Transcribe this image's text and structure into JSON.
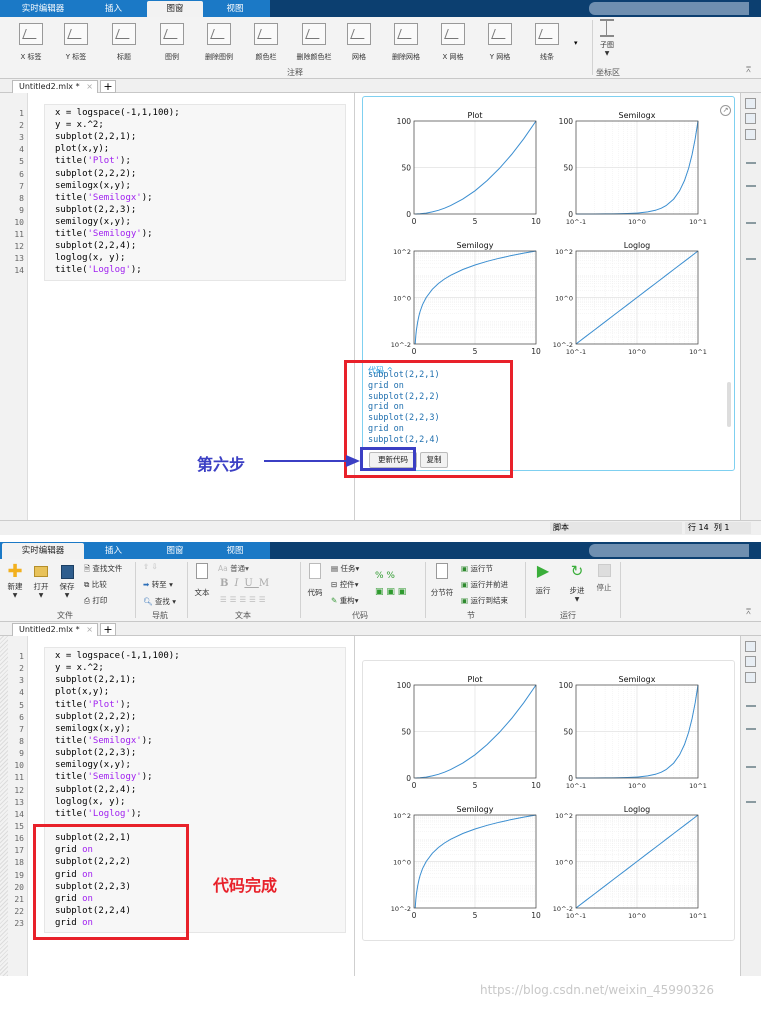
{
  "top": {
    "tabs": [
      "实时编辑器",
      "插入",
      "图窗",
      "视图"
    ],
    "active_tab": 2,
    "ribbon_items": [
      "X 标签",
      "Y 标签",
      "标题",
      "图例",
      "删除图例",
      "颜色栏",
      "删除颜色栏",
      "网格",
      "删除网格",
      "X 网格",
      "Y 网格",
      "线条"
    ],
    "subplot_label": "子图",
    "groups": [
      "注释",
      "坐标区"
    ],
    "doc_tab": "Untitled2.mlx *",
    "code_lines": [
      [
        [
          "x = logspace(-1,1,100);",
          "c"
        ]
      ],
      [
        [
          "y = x.^2;",
          "c"
        ]
      ],
      [
        [
          "subplot(2,2,1);",
          "c"
        ]
      ],
      [
        [
          "plot(x,y);",
          "c"
        ]
      ],
      [
        [
          "title(",
          "c"
        ],
        [
          "'Plot'",
          "s"
        ],
        [
          ");",
          "c"
        ]
      ],
      [
        [
          "subplot(2,2,2);",
          "c"
        ]
      ],
      [
        [
          "semilogx(x,y);",
          "c"
        ]
      ],
      [
        [
          "title(",
          "c"
        ],
        [
          "'Semilogx'",
          "s"
        ],
        [
          ");",
          "c"
        ]
      ],
      [
        [
          "subplot(2,2,3);",
          "c"
        ]
      ],
      [
        [
          "semilogy(x,y);",
          "c"
        ]
      ],
      [
        [
          "title(",
          "c"
        ],
        [
          "'Semilogy'",
          "s"
        ],
        [
          ");",
          "c"
        ]
      ],
      [
        [
          "subplot(2,2,4);",
          "c"
        ]
      ],
      [
        [
          "loglog(x, y);",
          "c"
        ]
      ],
      [
        [
          "title(",
          "c"
        ],
        [
          "'Loglog'",
          "s"
        ],
        [
          ");",
          "c"
        ]
      ]
    ],
    "generated_code": {
      "header": "代码 ^",
      "lines": [
        "subplot(2,2,1)",
        "grid on",
        "subplot(2,2,2)",
        "grid on",
        "subplot(2,2,3)",
        "grid on",
        "subplot(2,2,4)",
        "grid on"
      ],
      "update_button": "更新代码",
      "copy_button": "复制"
    },
    "annotation_step": "第六步",
    "status": {
      "mode": "脚本",
      "row_label": "行",
      "row": "14",
      "col_label": "列",
      "col": "1"
    }
  },
  "bottom": {
    "tabs": [
      "实时编辑器",
      "插入",
      "图窗",
      "视图"
    ],
    "active_tab": 0,
    "file": {
      "new": "新建",
      "open": "打开",
      "save": "保存",
      "find_files": "查找文件",
      "compare": "比较",
      "print": "打印",
      "group": "文件"
    },
    "nav": {
      "goto": "转至",
      "find": "查找",
      "group": "导航"
    },
    "text": {
      "text": "文本",
      "style": "普通",
      "bold": "B",
      "italic": "I",
      "underline": "U",
      "mono": "M",
      "group": "文本"
    },
    "code": {
      "code": "代码",
      "task": "任务",
      "control": "控件",
      "refactor": "重构",
      "group": "代码"
    },
    "section": {
      "break": "分节符",
      "run_section": "运行节",
      "run_advance": "运行并前进",
      "run_to_end": "运行到结束",
      "group": "节"
    },
    "run": {
      "run": "运行",
      "step": "步进",
      "stop": "停止",
      "group": "运行"
    },
    "doc_tab": "Untitled2.mlx *",
    "code_lines": [
      [
        [
          "x = logspace(-1,1,100);",
          "c"
        ]
      ],
      [
        [
          "y = x.^2;",
          "c"
        ]
      ],
      [
        [
          "subplot(2,2,1);",
          "c"
        ]
      ],
      [
        [
          "plot(x,y);",
          "c"
        ]
      ],
      [
        [
          "title(",
          "c"
        ],
        [
          "'Plot'",
          "s"
        ],
        [
          ");",
          "c"
        ]
      ],
      [
        [
          "subplot(2,2,2);",
          "c"
        ]
      ],
      [
        [
          "semilogx(x,y);",
          "c"
        ]
      ],
      [
        [
          "title(",
          "c"
        ],
        [
          "'Semilogx'",
          "s"
        ],
        [
          ");",
          "c"
        ]
      ],
      [
        [
          "subplot(2,2,3);",
          "c"
        ]
      ],
      [
        [
          "semilogy(x,y);",
          "c"
        ]
      ],
      [
        [
          "title(",
          "c"
        ],
        [
          "'Semilogy'",
          "s"
        ],
        [
          ");",
          "c"
        ]
      ],
      [
        [
          "subplot(2,2,4);",
          "c"
        ]
      ],
      [
        [
          "loglog(x, y);",
          "c"
        ]
      ],
      [
        [
          "title(",
          "c"
        ],
        [
          "'Loglog'",
          "s"
        ],
        [
          ");",
          "c"
        ]
      ],
      [],
      [
        [
          "subplot(2,2,1)",
          "c"
        ]
      ],
      [
        [
          "grid ",
          "c"
        ],
        [
          "on",
          "s"
        ]
      ],
      [
        [
          "subplot(2,2,2)",
          "c"
        ]
      ],
      [
        [
          "grid ",
          "c"
        ],
        [
          "on",
          "s"
        ]
      ],
      [
        [
          "subplot(2,2,3)",
          "c"
        ]
      ],
      [
        [
          "grid ",
          "c"
        ],
        [
          "on",
          "s"
        ]
      ],
      [
        [
          "subplot(2,2,4)",
          "c"
        ]
      ],
      [
        [
          "grid ",
          "c"
        ],
        [
          "on",
          "s"
        ]
      ]
    ],
    "annotation_done": "代码完成"
  },
  "figure": {
    "line_color": "#3b8ed0",
    "x": [
      0.1,
      0.15,
      0.2,
      0.3,
      0.4,
      0.5,
      0.7,
      1,
      1.5,
      2,
      2.5,
      3,
      4,
      5,
      6,
      7,
      8,
      9,
      10
    ],
    "y": [
      0.01,
      0.0225,
      0.04,
      0.09,
      0.16,
      0.25,
      0.49,
      1,
      2.25,
      4,
      6.25,
      9,
      16,
      25,
      36,
      49,
      64,
      81,
      100
    ],
    "grid": true,
    "subplots": [
      {
        "title": "Plot",
        "xscale": "linear",
        "yscale": "linear",
        "xlim": [
          0,
          10
        ],
        "ylim": [
          0,
          100
        ],
        "xticks": [
          0,
          5,
          10
        ],
        "xticklabels": [
          "0",
          "5",
          "10"
        ],
        "yticks": [
          0,
          50,
          100
        ],
        "yticklabels": [
          "0",
          "50",
          "100"
        ]
      },
      {
        "title": "Semilogx",
        "xscale": "log",
        "yscale": "linear",
        "xlim": [
          0.1,
          10
        ],
        "ylim": [
          0,
          100
        ],
        "xticks": [
          0.1,
          1,
          10
        ],
        "xticklabels": [
          "10^-1",
          "10^0",
          "10^1"
        ],
        "yticks": [
          0,
          50,
          100
        ],
        "yticklabels": [
          "0",
          "50",
          "100"
        ]
      },
      {
        "title": "Semilogy",
        "xscale": "linear",
        "yscale": "log",
        "xlim": [
          0,
          10
        ],
        "ylim": [
          0.01,
          100
        ],
        "xticks": [
          0,
          5,
          10
        ],
        "xticklabels": [
          "0",
          "5",
          "10"
        ],
        "yticks": [
          0.01,
          1,
          100
        ],
        "yticklabels": [
          "10^-2",
          "10^0",
          "10^2"
        ]
      },
      {
        "title": "Loglog",
        "xscale": "log",
        "yscale": "log",
        "xlim": [
          0.1,
          10
        ],
        "ylim": [
          0.01,
          100
        ],
        "xticks": [
          0.1,
          1,
          10
        ],
        "xticklabels": [
          "10^-1",
          "10^0",
          "10^1"
        ],
        "yticks": [
          0.01,
          1,
          100
        ],
        "yticklabels": [
          "10^-2",
          "10^0",
          "10^2"
        ]
      }
    ]
  },
  "watermark": "https://blog.csdn.net/weixin_45990326",
  "colors": {
    "tabbar": "#0c3f70",
    "active_tab": "#1b79c6",
    "annotation_red": "#e8212a",
    "annotation_blue": "#3b3fc4",
    "code_string": "#a020f0",
    "panel_border": "#7fd0f0"
  }
}
